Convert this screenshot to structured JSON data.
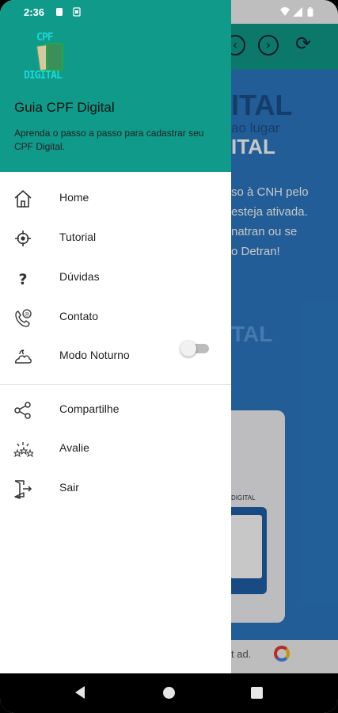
{
  "status_bar": {
    "time": "2:36"
  },
  "toolbar": {
    "nav_icons": [
      "chevron-left-icon",
      "chevron-right-icon",
      "refresh-icon"
    ]
  },
  "background": {
    "big_1": "ITAL",
    "faint_1": "ao lugar",
    "big_2": "ITAL",
    "line_1": "so à CNH pelo",
    "line_2": "esteja ativada.",
    "line_3": "natran ou se",
    "line_4": "o Detran!",
    "big_3": "TAL",
    "card_label": "DIGITAL",
    "ad_text": "t ad."
  },
  "drawer": {
    "logo_top": "CPF",
    "logo_bottom": "DIGITAL",
    "title": "Guia CPF Digital",
    "subtitle": "Aprenda o passo a passo para cadastrar seu CPF Digital.",
    "items": [
      {
        "label": "Home",
        "icon": "home-icon"
      },
      {
        "label": "Tutorial",
        "icon": "target-icon"
      },
      {
        "label": "Dúvidas",
        "icon": "question-icon"
      },
      {
        "label": "Contato",
        "icon": "phone-icon"
      },
      {
        "label": "Modo Noturno",
        "icon": "cloud-moon-icon"
      }
    ],
    "night_mode_on": false,
    "items2": [
      {
        "label": "Compartilhe",
        "icon": "share-icon"
      },
      {
        "label": "Avalie",
        "icon": "rate-icon"
      },
      {
        "label": "Sair",
        "icon": "exit-icon"
      }
    ]
  },
  "colors": {
    "header": "#0f9a8a",
    "background_app": "#2c78c2"
  }
}
